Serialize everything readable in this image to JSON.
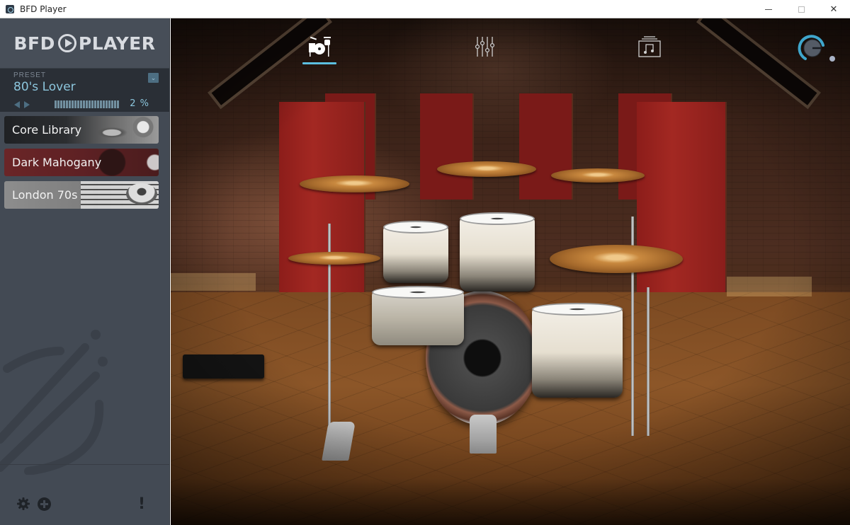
{
  "window": {
    "title": "BFD Player",
    "controls": {
      "minimize": "minimize",
      "maximize": "maximize",
      "close": "✕"
    }
  },
  "sidebar": {
    "logo": {
      "left": "BFD",
      "right": "PLAYER"
    },
    "preset": {
      "label": "PRESET",
      "name": "80's Lover",
      "load_progress_text": "2 %",
      "load_progress_percent": 2
    },
    "kits": [
      {
        "label": "Core Library",
        "style": "dark"
      },
      {
        "label": "Dark Mahogany",
        "style": "red"
      },
      {
        "label": "London 70s",
        "style": "grey"
      }
    ],
    "footer": {
      "alert_symbol": "!"
    }
  },
  "stage": {
    "tabs": [
      {
        "name": "drum-kit",
        "active": true
      },
      {
        "name": "mixer",
        "active": false
      },
      {
        "name": "grooves",
        "active": false
      }
    ],
    "accent_color": "#5bbfe0",
    "master_volume_fraction": 0.75
  }
}
